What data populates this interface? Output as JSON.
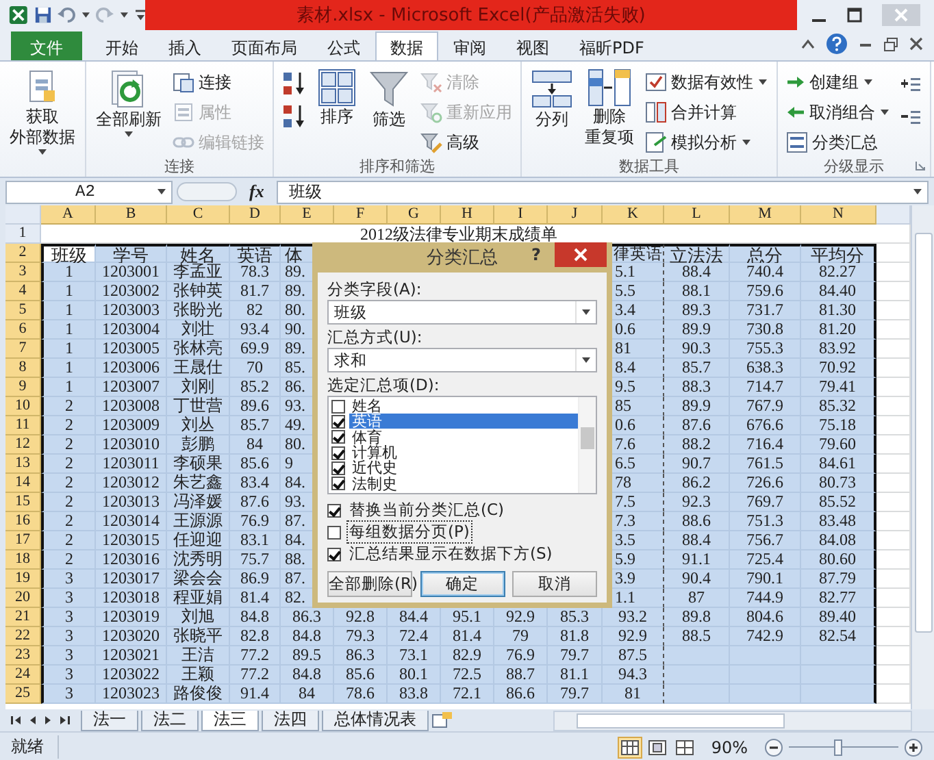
{
  "window": {
    "title": "素材.xlsx - Microsoft Excel(产品激活失败)"
  },
  "menu_tabs": [
    {
      "label": "文件",
      "kind": "file",
      "selected": false
    },
    {
      "label": "开始",
      "kind": "tab",
      "selected": false
    },
    {
      "label": "插入",
      "kind": "tab",
      "selected": false
    },
    {
      "label": "页面布局",
      "kind": "tab",
      "selected": false
    },
    {
      "label": "公式",
      "kind": "tab",
      "selected": false
    },
    {
      "label": "数据",
      "kind": "tab",
      "selected": true
    },
    {
      "label": "审阅",
      "kind": "tab",
      "selected": false
    },
    {
      "label": "视图",
      "kind": "tab",
      "selected": false
    },
    {
      "label": "福昕PDF",
      "kind": "tab",
      "selected": false
    }
  ],
  "ribbon": {
    "groups": [
      {
        "items": [
          {
            "kind": "big",
            "lines": [
              "获取",
              "外部数据"
            ],
            "dropdown": true,
            "disabled": false
          }
        ]
      },
      {
        "label": "连接",
        "items": [
          {
            "kind": "big",
            "lines": [
              "全部刷新"
            ],
            "dropdown": true,
            "disabled": false
          },
          {
            "kind": "small",
            "lines": [
              "连接"
            ],
            "dropdown": false,
            "disabled": false
          },
          {
            "kind": "small",
            "lines": [
              "属性"
            ],
            "dropdown": false,
            "disabled": true
          },
          {
            "kind": "small",
            "lines": [
              "编辑链接"
            ],
            "dropdown": false,
            "disabled": true
          }
        ]
      },
      {
        "label": "排序和筛选",
        "items": [
          {
            "kind": "icon",
            "dropdown": false,
            "disabled": false
          },
          {
            "kind": "icon",
            "dropdown": false,
            "disabled": false
          },
          {
            "kind": "big",
            "lines": [
              "排序"
            ],
            "dropdown": false,
            "disabled": false
          },
          {
            "kind": "big",
            "lines": [
              "筛选"
            ],
            "dropdown": false,
            "disabled": false
          },
          {
            "kind": "small",
            "lines": [
              "清除"
            ],
            "dropdown": false,
            "disabled": true
          },
          {
            "kind": "small",
            "lines": [
              "重新应用"
            ],
            "dropdown": false,
            "disabled": true
          },
          {
            "kind": "small",
            "lines": [
              "高级"
            ],
            "dropdown": false,
            "disabled": false
          }
        ]
      },
      {
        "label": "数据工具",
        "items": [
          {
            "kind": "big",
            "lines": [
              "分列"
            ],
            "dropdown": false,
            "disabled": false
          },
          {
            "kind": "big",
            "lines": [
              "删除",
              "重复项"
            ],
            "dropdown": false,
            "disabled": false
          },
          {
            "kind": "small",
            "lines": [
              "数据有效性"
            ],
            "dropdown": true,
            "disabled": false
          },
          {
            "kind": "small",
            "lines": [
              "合并计算"
            ],
            "dropdown": false,
            "disabled": false
          },
          {
            "kind": "small",
            "lines": [
              "模拟分析"
            ],
            "dropdown": true,
            "disabled": false
          }
        ]
      },
      {
        "label": "分级显示",
        "launcher": true,
        "items": [
          {
            "kind": "small",
            "lines": [
              "创建组"
            ],
            "dropdown": true,
            "disabled": false
          },
          {
            "kind": "small",
            "lines": [
              "取消组合"
            ],
            "dropdown": true,
            "disabled": false
          },
          {
            "kind": "small",
            "lines": [
              "分类汇总"
            ],
            "dropdown": false,
            "disabled": false
          },
          {
            "kind": "icon",
            "dropdown": false,
            "disabled": false
          },
          {
            "kind": "icon",
            "dropdown": false,
            "disabled": false
          }
        ]
      }
    ]
  },
  "formula_bar": {
    "name_box": "A2",
    "function_label": "fx",
    "content": "班级"
  },
  "sheet": {
    "columns": [
      {
        "label": "A",
        "selected": true
      },
      {
        "label": "B",
        "selected": true
      },
      {
        "label": "C",
        "selected": true
      },
      {
        "label": "D",
        "selected": true
      },
      {
        "label": "E",
        "selected": true
      },
      {
        "label": "F",
        "selected": true
      },
      {
        "label": "G",
        "selected": true
      },
      {
        "label": "H",
        "selected": true
      },
      {
        "label": "I",
        "selected": true
      },
      {
        "label": "J",
        "selected": true
      },
      {
        "label": "K",
        "selected": true
      },
      {
        "label": "L",
        "selected": true
      },
      {
        "label": "M",
        "selected": true
      },
      {
        "label": "N",
        "selected": true
      }
    ],
    "rows": [
      {
        "header": "1",
        "selected": false,
        "title": "2012级法律专业期末成绩单"
      },
      {
        "header": "2",
        "selected": true,
        "active": true,
        "cells": [
          "班级",
          "学号",
          "姓名",
          "英语",
          "体",
          null,
          null,
          null,
          null,
          null,
          "律英语",
          "立法法",
          "总分",
          "平均分"
        ]
      },
      {
        "header": "3",
        "selected": true,
        "active": false,
        "cells": [
          "1",
          "1203001",
          "李孟亚",
          "78.3",
          "89.",
          null,
          null,
          null,
          null,
          null,
          "5.1",
          "88.4",
          "740.4",
          "82.27"
        ]
      },
      {
        "header": "4",
        "selected": true,
        "active": false,
        "cells": [
          "1",
          "1203002",
          "张钟英",
          "81.7",
          "89.",
          null,
          null,
          null,
          null,
          null,
          "5.5",
          "88.1",
          "759.6",
          "84.40"
        ]
      },
      {
        "header": "5",
        "selected": true,
        "active": false,
        "cells": [
          "1",
          "1203003",
          "张盼光",
          "82",
          "80.",
          null,
          null,
          null,
          null,
          null,
          "3.4",
          "89.3",
          "731.7",
          "81.30"
        ]
      },
      {
        "header": "6",
        "selected": true,
        "active": false,
        "cells": [
          "1",
          "1203004",
          "刘壮",
          "93.4",
          "90.",
          null,
          null,
          null,
          null,
          null,
          "0.6",
          "89.9",
          "730.8",
          "81.20"
        ]
      },
      {
        "header": "7",
        "selected": true,
        "active": false,
        "cells": [
          "1",
          "1203005",
          "张林亮",
          "69.9",
          "89.",
          null,
          null,
          null,
          null,
          null,
          "81",
          "90.3",
          "755.3",
          "83.92"
        ]
      },
      {
        "header": "8",
        "selected": true,
        "active": false,
        "cells": [
          "1",
          "1203006",
          "王晟仕",
          "70",
          "85.",
          null,
          null,
          null,
          null,
          null,
          "8.4",
          "85.7",
          "638.3",
          "70.92"
        ]
      },
      {
        "header": "9",
        "selected": true,
        "active": false,
        "cells": [
          "1",
          "1203007",
          "刘刚",
          "85.2",
          "86.",
          null,
          null,
          null,
          null,
          null,
          "9.5",
          "88.3",
          "714.7",
          "79.41"
        ]
      },
      {
        "header": "10",
        "selected": true,
        "active": false,
        "cells": [
          "2",
          "1203008",
          "丁世营",
          "89.6",
          "93.",
          null,
          null,
          null,
          null,
          null,
          "85",
          "89.9",
          "767.9",
          "85.32"
        ]
      },
      {
        "header": "11",
        "selected": true,
        "active": false,
        "cells": [
          "2",
          "1203009",
          "刘丛",
          "85.7",
          "49.",
          null,
          null,
          null,
          null,
          null,
          "0.6",
          "87.6",
          "676.6",
          "75.18"
        ]
      },
      {
        "header": "12",
        "selected": true,
        "active": false,
        "cells": [
          "2",
          "1203010",
          "彭鹏",
          "84",
          "80.",
          null,
          null,
          null,
          null,
          null,
          "7.6",
          "88.2",
          "716.4",
          "79.60"
        ]
      },
      {
        "header": "13",
        "selected": true,
        "active": false,
        "cells": [
          "2",
          "1203011",
          "李硕果",
          "85.6",
          "9",
          null,
          null,
          null,
          null,
          null,
          "6.5",
          "90.7",
          "761.5",
          "84.61"
        ]
      },
      {
        "header": "14",
        "selected": true,
        "active": false,
        "cells": [
          "2",
          "1203012",
          "朱艺鑫",
          "83.4",
          "84.",
          null,
          null,
          null,
          null,
          null,
          "78",
          "86.2",
          "726.6",
          "80.73"
        ]
      },
      {
        "header": "15",
        "selected": true,
        "active": false,
        "cells": [
          "2",
          "1203013",
          "冯泽媛",
          "87.6",
          "93.",
          null,
          null,
          null,
          null,
          null,
          "7.5",
          "92.3",
          "769.7",
          "85.52"
        ]
      },
      {
        "header": "16",
        "selected": true,
        "active": false,
        "cells": [
          "2",
          "1203014",
          "王源源",
          "76.9",
          "87.",
          null,
          null,
          null,
          null,
          null,
          "7.3",
          "88.6",
          "751.3",
          "83.48"
        ]
      },
      {
        "header": "17",
        "selected": true,
        "active": false,
        "cells": [
          "2",
          "1203015",
          "任迎迎",
          "83.1",
          "84.",
          null,
          null,
          null,
          null,
          null,
          "3.5",
          "88.4",
          "756.7",
          "84.08"
        ]
      },
      {
        "header": "18",
        "selected": true,
        "active": false,
        "cells": [
          "2",
          "1203016",
          "沈秀明",
          "75.7",
          "88.",
          null,
          null,
          null,
          null,
          null,
          "5.9",
          "91.1",
          "725.4",
          "80.60"
        ]
      },
      {
        "header": "19",
        "selected": true,
        "active": false,
        "cells": [
          "3",
          "1203017",
          "梁会会",
          "86.9",
          "87.",
          null,
          null,
          null,
          null,
          null,
          "3.9",
          "90.4",
          "790.1",
          "87.79"
        ]
      },
      {
        "header": "20",
        "selected": true,
        "active": false,
        "cells": [
          "3",
          "1203018",
          "程亚娟",
          "81.4",
          "82.",
          null,
          null,
          null,
          null,
          null,
          "1.1",
          "87",
          "744.9",
          "82.77"
        ]
      },
      {
        "header": "21",
        "selected": true,
        "active": false,
        "cells": [
          "3",
          "1203019",
          "刘旭",
          "84.8",
          "86.3",
          "92.8",
          "84.4",
          "95.1",
          "92.9",
          "85.3",
          "93.2",
          "89.8",
          "804.6",
          "89.40"
        ]
      },
      {
        "header": "22",
        "selected": true,
        "active": false,
        "cells": [
          "3",
          "1203020",
          "张晓平",
          "82.8",
          "84.8",
          "79.3",
          "72.4",
          "81.4",
          "79",
          "81.8",
          "92.9",
          "88.5",
          "742.9",
          "82.54"
        ]
      },
      {
        "header": "23",
        "selected": true,
        "active": false,
        "cells": [
          "3",
          "1203021",
          "王洁",
          "77.2",
          "89.5",
          "86.3",
          "73.1",
          "82.9",
          "76.9",
          "79.7",
          "87.5",
          null,
          null,
          null
        ]
      },
      {
        "header": "24",
        "selected": true,
        "active": false,
        "cells": [
          "3",
          "1203022",
          "王颖",
          "77.2",
          "84.8",
          "85.6",
          "80.1",
          "72.5",
          "88.7",
          "81.1",
          "94.3",
          null,
          null,
          null
        ]
      },
      {
        "header": "25",
        "selected": true,
        "active": false,
        "cells": [
          "3",
          "1203023",
          "路俊俊",
          "91.4",
          "84",
          "78.6",
          "83.8",
          "72.1",
          "86.6",
          "79.7",
          "81",
          null,
          null,
          null
        ]
      }
    ]
  },
  "dialog": {
    "title": "分类汇总",
    "help": "?",
    "fields": [
      {
        "label": "分类字段(A):",
        "value": "班级"
      },
      {
        "label": "汇总方式(U):",
        "value": "求和"
      }
    ],
    "list_label": "选定汇总项(D):",
    "list_items": [
      {
        "label": "姓名",
        "checked": false,
        "selected": false
      },
      {
        "label": "英语",
        "checked": true,
        "selected": true
      },
      {
        "label": "体育",
        "checked": true,
        "selected": false
      },
      {
        "label": "计算机",
        "checked": true,
        "selected": false
      },
      {
        "label": "近代史",
        "checked": true,
        "selected": false
      },
      {
        "label": "法制史",
        "checked": true,
        "selected": false
      }
    ],
    "options": [
      {
        "label": "替换当前分类汇总(C)",
        "checked": true,
        "focused": false
      },
      {
        "label": "每组数据分页(P)",
        "checked": false,
        "focused": true
      },
      {
        "label": "汇总结果显示在数据下方(S)",
        "checked": true,
        "focused": false
      }
    ],
    "buttons": [
      {
        "label": "全部删除(R)",
        "default": false
      },
      {
        "label": "确定",
        "default": true
      },
      {
        "label": "取消",
        "default": false
      }
    ]
  },
  "sheet_tabs": [
    {
      "label": "法一",
      "selected": false
    },
    {
      "label": "法二",
      "selected": false
    },
    {
      "label": "法三",
      "selected": true
    },
    {
      "label": "法四",
      "selected": false
    },
    {
      "label": "总体情况表",
      "selected": false
    }
  ],
  "status_bar": {
    "text": "就绪",
    "view_buttons": [
      {
        "selected": true
      },
      {
        "selected": false
      },
      {
        "selected": false
      }
    ],
    "zoom": "90%",
    "zoom_slider": {
      "level": 0.45
    }
  }
}
